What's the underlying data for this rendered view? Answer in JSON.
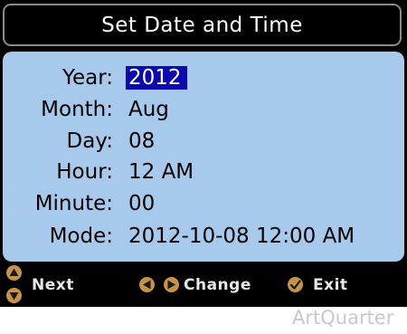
{
  "title": "Set Date and Time",
  "fields": [
    {
      "label": "Year:",
      "value": "2012"
    },
    {
      "label": "Month:",
      "value": "Aug"
    },
    {
      "label": "Day:",
      "value": "08"
    },
    {
      "label": "Hour:",
      "value": "12 AM"
    },
    {
      "label": "Minute:",
      "value": "00"
    },
    {
      "label": "Mode:",
      "value": "2012-10-08 12:00 AM"
    }
  ],
  "footer": {
    "next_label": "Next",
    "change_label": "Change",
    "exit_label": "Exit"
  },
  "watermark": "ArtQuarter",
  "colors": {
    "panel": "#a7c9ec",
    "selection": "#0a0ab0",
    "icon": "#c59246",
    "background": "#000000"
  },
  "icons": {
    "up": "triangle-up-icon",
    "down": "triangle-down-icon",
    "left": "triangle-left-icon",
    "right": "triangle-right-icon",
    "check": "checkmark-icon"
  }
}
